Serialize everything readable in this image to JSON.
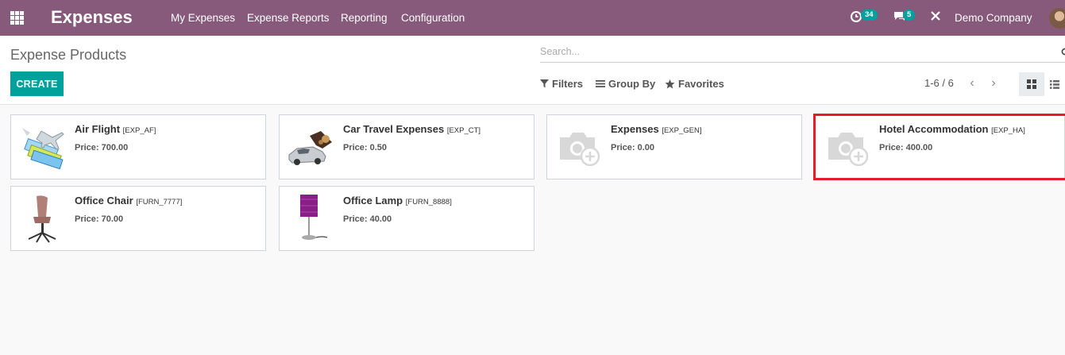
{
  "navbar": {
    "app_title": "Expenses",
    "menu": [
      "My Expenses",
      "Expense Reports",
      "Reporting",
      "Configuration"
    ],
    "activity_count": "34",
    "message_count": "5",
    "company": "Demo Company"
  },
  "control_panel": {
    "title": "Expense Products",
    "create_label": "CREATE",
    "search_placeholder": "Search...",
    "filters_label": "Filters",
    "group_by_label": "Group By",
    "favorites_label": "Favorites",
    "pager": "1-6 / 6"
  },
  "products": [
    {
      "name": "Air Flight",
      "code": "[EXP_AF]",
      "price": "Price: 700.00",
      "image": "air-flight-image"
    },
    {
      "name": "Car Travel Expenses",
      "code": "[EXP_CT]",
      "price": "Price: 0.50",
      "image": "car-image"
    },
    {
      "name": "Expenses",
      "code": "[EXP_GEN]",
      "price": "Price: 0.00",
      "image": "placeholder-camera-image"
    },
    {
      "name": "Hotel Accommodation",
      "code": "[EXP_HA]",
      "price": "Price: 400.00",
      "image": "placeholder-camera-image"
    },
    {
      "name": "Office Chair",
      "code": "[FURN_7777]",
      "price": "Price: 70.00",
      "image": "chair-image"
    },
    {
      "name": "Office Lamp",
      "code": "[FURN_8888]",
      "price": "Price: 40.00",
      "image": "lamp-image"
    }
  ],
  "colors": {
    "navbar": "#875a7b",
    "primary": "#00a09d",
    "highlight": "#e41e26"
  }
}
